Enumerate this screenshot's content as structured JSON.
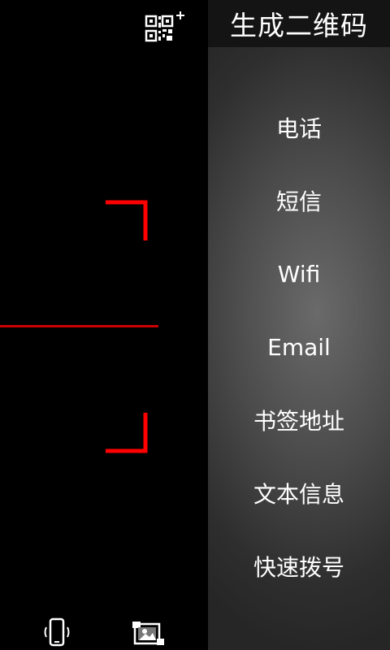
{
  "panel": {
    "title": "生成二维码",
    "items": [
      {
        "label": "电话"
      },
      {
        "label": "短信"
      },
      {
        "label": "Wifi"
      },
      {
        "label": "Email"
      },
      {
        "label": "书签地址"
      },
      {
        "label": "文本信息"
      },
      {
        "label": "快速拨号"
      }
    ]
  },
  "colors": {
    "scan_frame": "#ff0000",
    "scan_line": "#cc0000",
    "header_bg": "#141414"
  },
  "icons": {
    "top": "qr-code-add-icon",
    "bottom_left": "vibrate-icon",
    "bottom_right": "gallery-icon"
  }
}
